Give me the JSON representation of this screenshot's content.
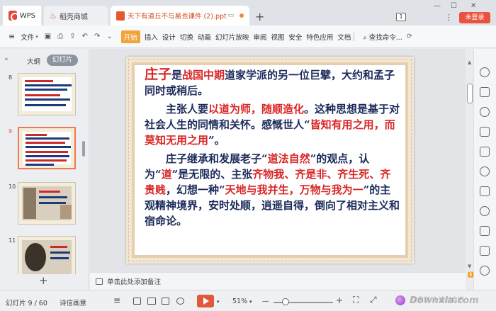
{
  "titlebar": {
    "wps_tab": "WPS",
    "store_tab": "稻壳商城",
    "doc_tab": "天下有道丘不与易也课件 (2).ppt",
    "new_tab": "+",
    "page_badge": "1",
    "login": "未登录",
    "more": "⋮",
    "minimize": "—",
    "maximize": "☐",
    "close": "✕"
  },
  "menubar": {
    "hamburger": "≡",
    "file": "文件",
    "start": "开始",
    "items": [
      "插入",
      "设计",
      "切换",
      "动画",
      "幻灯片放映",
      "审阅",
      "视图",
      "安全",
      "特色应用",
      "文档"
    ],
    "search": "查找命令...",
    "sync": "⟳"
  },
  "leftpanel": {
    "outline_tab": "大纲",
    "slides_tab": "幻灯片",
    "collapse": "«",
    "thumbs": [
      {
        "num": "8",
        "active": false
      },
      {
        "num": "9",
        "active": true
      },
      {
        "num": "10",
        "active": false
      },
      {
        "num": "11",
        "active": false
      }
    ],
    "add": "+"
  },
  "slide": {
    "p1": {
      "a": "庄子",
      "b": "是",
      "c": "战国中期",
      "d": "道家学派的另一位巨擘，大约和孟子同时或稍后。"
    },
    "p2": {
      "a": "主张人要",
      "b": "以道为师，随顺造化",
      "c": "。这种思想是基于对社会人生的同情和关怀。感慨世人“",
      "d": "皆知有用之用，而莫知无用之用",
      "e": "”。"
    },
    "p3": {
      "a": "庄子继承和发展老子“",
      "b": "道法自然",
      "c": "”的观点，认为“",
      "d": "道",
      "e": "”是无限的、主张",
      "f": "齐物我、齐是非、齐生死、齐贵贱",
      "g": "，幻想一种“",
      "h": "天地与我并生，万物与我为一",
      "i": "”的主观精神境界，安时处顺，逍遥自得，倒向了相对主义和宿命论。"
    }
  },
  "notes": {
    "placeholder": "单击此处添加备注"
  },
  "status": {
    "slide_counter": "幻灯片 9 / 60",
    "theme": "诗信画意",
    "zoom": "51%",
    "minus": "—",
    "plus": "+",
    "caret": "▾"
  },
  "watermark": {
    "text": "Downxia.com",
    "sub": "仅供学习·请勿商用"
  }
}
